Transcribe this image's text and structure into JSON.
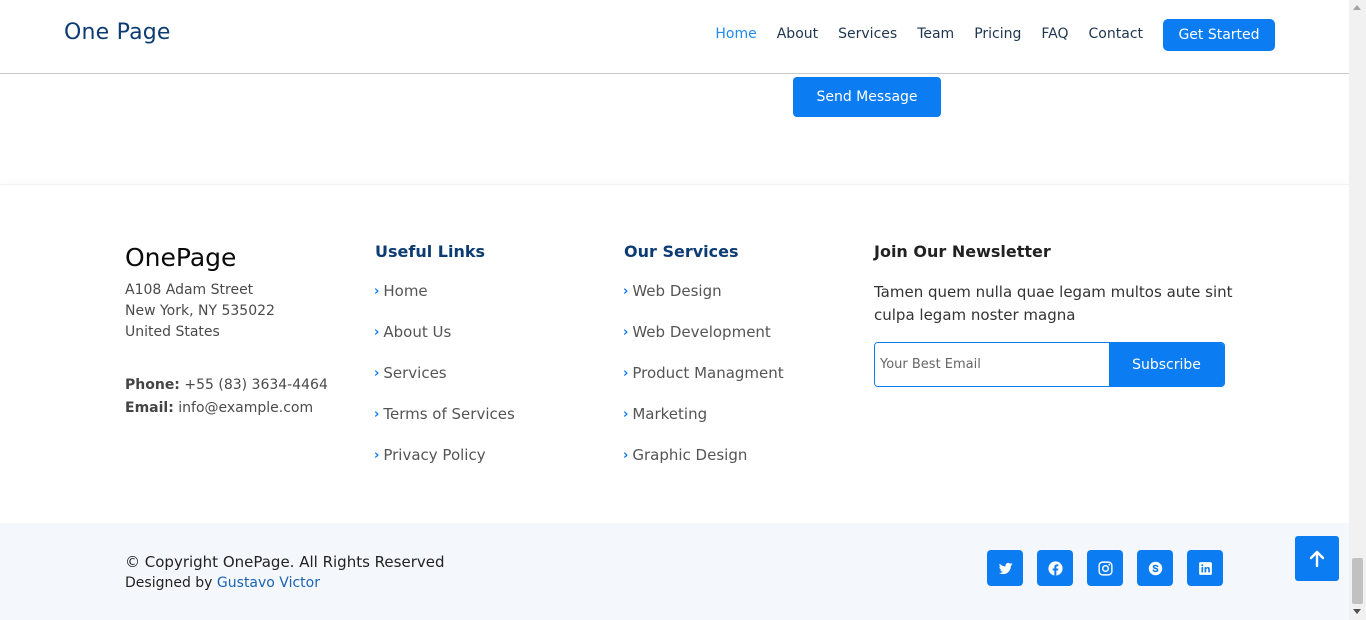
{
  "header": {
    "logo": "One Page",
    "nav": [
      "Home",
      "About",
      "Services",
      "Team",
      "Pricing",
      "FAQ",
      "Contact"
    ],
    "active_nav": "Home",
    "cta": "Get Started"
  },
  "contact": {
    "send_label": "Send Message"
  },
  "footer": {
    "brand": "OnePage",
    "address": [
      "A108 Adam Street",
      "New York, NY 535022",
      "United States"
    ],
    "phone_label": "Phone:",
    "phone": "+55 (83) 3634-4464",
    "email_label": "Email:",
    "email": "info@example.com",
    "useful_links": {
      "title": "Useful Links",
      "items": [
        "Home",
        "About Us",
        "Services",
        "Terms of Services",
        "Privacy Policy"
      ]
    },
    "our_services": {
      "title": "Our Services",
      "items": [
        "Web Design",
        "Web Development",
        "Product Managment",
        "Marketing",
        "Graphic Design"
      ]
    },
    "newsletter": {
      "title": "Join Our Newsletter",
      "text": "Tamen quem nulla quae legam multos aute sint culpa legam noster magna",
      "placeholder": "Your Best Email",
      "button": "Subscribe"
    },
    "copyright": "© Copyright OnePage. All Rights Reserved",
    "designed_prefix": "Designed by ",
    "designer": "Gustavo Victor",
    "socials": [
      "twitter-icon",
      "facebook-icon",
      "instagram-icon",
      "skype-icon",
      "linkedin-icon"
    ]
  },
  "colors": {
    "accent": "#0b7cf1",
    "heading": "#0d3c73",
    "footer_bottom_bg": "#f4f8fc"
  }
}
